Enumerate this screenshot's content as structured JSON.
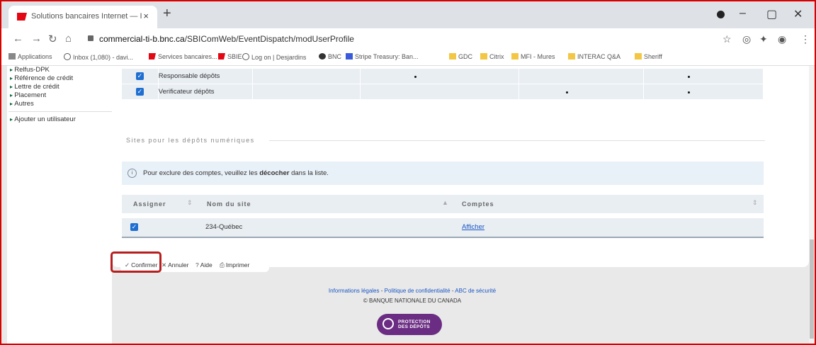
{
  "browser": {
    "tab_title": "Solutions bancaires Internet — I",
    "tab_close": "×",
    "new_tab": "+",
    "url_host": "commercial-ti-b.bnc.ca",
    "url_path": "/SBIComWeb/EventDispatch/modUserProfile"
  },
  "bookmarks": [
    {
      "label": "Applications",
      "icon": "apps-grid-icon"
    },
    {
      "label": "Inbox (1,080) - davi...",
      "icon": "gmail-icon"
    },
    {
      "label": "Services bancaires...",
      "icon": "bnc-icon"
    },
    {
      "label": "SBIE",
      "icon": "bnc-icon"
    },
    {
      "label": "Log on | Desjardins",
      "icon": "desjardins-icon"
    },
    {
      "label": "BNC",
      "icon": "globe-icon"
    },
    {
      "label": "Stripe Treasury: Ban...",
      "icon": "stripe-icon"
    },
    {
      "label": "GDC",
      "icon": "folder-icon"
    },
    {
      "label": "Citrix",
      "icon": "folder-icon"
    },
    {
      "label": "MFI - Mures",
      "icon": "folder-icon"
    },
    {
      "label": "INTERAC Q&A",
      "icon": "folder-icon"
    },
    {
      "label": "Sheriff",
      "icon": "folder-icon"
    }
  ],
  "leftnav": {
    "items": [
      "Relfus-DPK",
      "Référence de crédit",
      "Lettre de crédit",
      "Placement",
      "Autres"
    ],
    "add_user": "Ajouter un utilisateur"
  },
  "roles": [
    {
      "label": "Responsable dépôts",
      "checked": true
    },
    {
      "label": "Verificateur dépôts",
      "checked": true
    }
  ],
  "section_title": "Sites pour les dépôts numériques",
  "info": {
    "prefix": "Pour exclure des comptes, veuillez les ",
    "bold": "décocher",
    "suffix": " dans la liste."
  },
  "sites_table": {
    "headers": {
      "assign": "Assigner",
      "site": "Nom du site",
      "accounts": "Comptes"
    },
    "rows": [
      {
        "assigned": true,
        "site": "234-Québec",
        "accounts_link": "Afficher"
      }
    ]
  },
  "actions": {
    "confirm": "Confirmer",
    "cancel": "Annuler",
    "help": "Aide",
    "print": "Imprimer"
  },
  "footer": {
    "links": [
      "Informations légales",
      "Politique de confidentialité",
      "ABC de sécurité"
    ],
    "copyright": "© BANQUE NATIONALE DU CANADA",
    "badge_line1": "PROTECTION",
    "badge_line2": "DES DÉPÔTS"
  },
  "colors": {
    "highlight_border": "#b71e1e",
    "frame_border": "#d90000",
    "badge": "#6b2d83",
    "checkbox": "#1f6fd1"
  }
}
